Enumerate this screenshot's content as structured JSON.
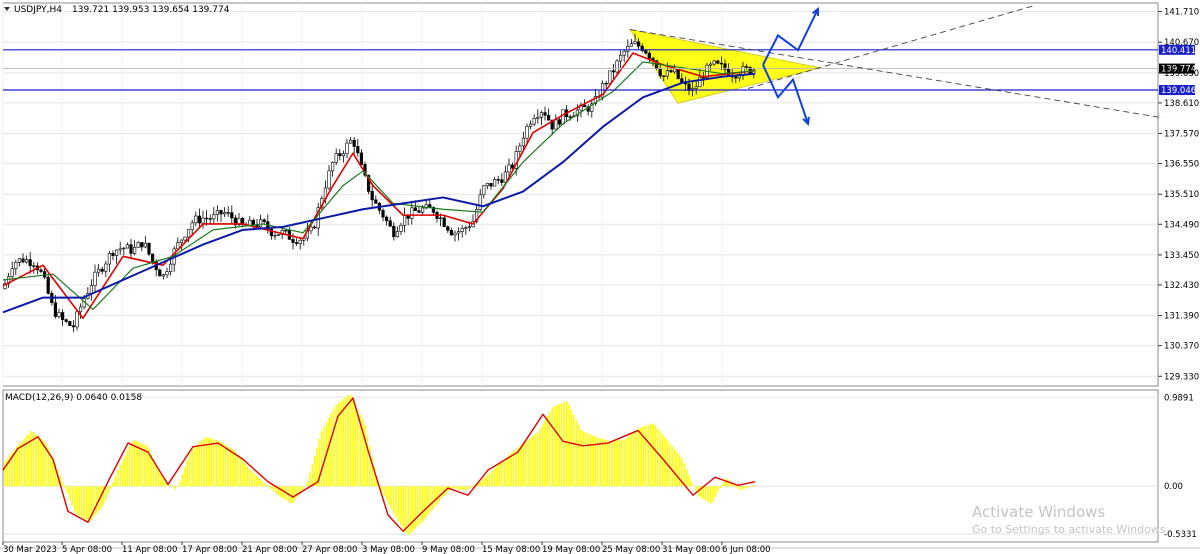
{
  "header": {
    "symbol": "USDJPY,H4",
    "ohlc": "139.721 139.953 139.654 139.774",
    "menu_icon": "triangle-down-icon"
  },
  "macd_label": "MACD(12,26,9) 0.0640 0.0158",
  "price_axis": {
    "ticks": [
      "141.710",
      "140.670",
      "139.630",
      "138.610",
      "137.570",
      "136.550",
      "135.510",
      "134.490",
      "133.450",
      "132.430",
      "131.390",
      "130.370",
      "129.330"
    ],
    "tags": {
      "upper": "140.411",
      "lower": "139.046",
      "current": "139.774"
    }
  },
  "macd_axis": {
    "ticks": [
      "0.9891",
      "0.00",
      "-0.5331"
    ]
  },
  "time_axis": [
    "30 Mar 2023",
    "5 Apr 08:00",
    "11 Apr 08:00",
    "17 Apr 08:00",
    "21 Apr 08:00",
    "27 Apr 08:00",
    "3 May 08:00",
    "9 May 08:00",
    "15 May 08:00",
    "19 May 08:00",
    "25 May 08:00",
    "31 May 08:00",
    "6 Jun 08:00"
  ],
  "watermark": {
    "title": "Activate Windows",
    "subtitle": "Go to Settings to activate Windows."
  },
  "colors": {
    "ma_fast": "#e00000",
    "ma_mid": "#1a7a1a",
    "ma_slow": "#0a1aa8",
    "hline": "#1a20c8",
    "triangle": "#ffff00",
    "macd_hist": "#ffff00",
    "macd_signal": "#e00000",
    "arrows": "#1040e0",
    "price_tag": "#1a20c8",
    "current_tag": "#000000"
  },
  "chart_data": {
    "type": "candlestick",
    "symbol": "USDJPY",
    "timeframe": "H4",
    "ylim": [
      129.0,
      142.0
    ],
    "horizontal_levels": [
      140.411,
      139.046
    ],
    "current_price": 139.774,
    "close_path": [
      {
        "x": 0,
        "y": 132.3
      },
      {
        "x": 10,
        "y": 133.2
      },
      {
        "x": 20,
        "y": 133.3
      },
      {
        "x": 32,
        "y": 133.2
      },
      {
        "x": 40,
        "y": 132.7
      },
      {
        "x": 50,
        "y": 131.6
      },
      {
        "x": 60,
        "y": 131.2
      },
      {
        "x": 70,
        "y": 131.0
      },
      {
        "x": 80,
        "y": 131.9
      },
      {
        "x": 90,
        "y": 132.6
      },
      {
        "x": 100,
        "y": 133.1
      },
      {
        "x": 110,
        "y": 133.6
      },
      {
        "x": 120,
        "y": 133.7
      },
      {
        "x": 130,
        "y": 133.6
      },
      {
        "x": 140,
        "y": 133.9
      },
      {
        "x": 150,
        "y": 133.2
      },
      {
        "x": 160,
        "y": 132.7
      },
      {
        "x": 170,
        "y": 133.5
      },
      {
        "x": 180,
        "y": 134.1
      },
      {
        "x": 190,
        "y": 134.6
      },
      {
        "x": 200,
        "y": 134.7
      },
      {
        "x": 210,
        "y": 134.7
      },
      {
        "x": 220,
        "y": 134.9
      },
      {
        "x": 230,
        "y": 134.7
      },
      {
        "x": 240,
        "y": 134.4
      },
      {
        "x": 250,
        "y": 134.5
      },
      {
        "x": 260,
        "y": 134.5
      },
      {
        "x": 270,
        "y": 134.2
      },
      {
        "x": 280,
        "y": 134.2
      },
      {
        "x": 290,
        "y": 134.0
      },
      {
        "x": 300,
        "y": 134.0
      },
      {
        "x": 310,
        "y": 134.3
      },
      {
        "x": 320,
        "y": 135.6
      },
      {
        "x": 330,
        "y": 136.6
      },
      {
        "x": 340,
        "y": 137.0
      },
      {
        "x": 350,
        "y": 137.4
      },
      {
        "x": 360,
        "y": 136.2
      },
      {
        "x": 370,
        "y": 135.3
      },
      {
        "x": 380,
        "y": 134.8
      },
      {
        "x": 390,
        "y": 134.2
      },
      {
        "x": 400,
        "y": 134.7
      },
      {
        "x": 410,
        "y": 134.9
      },
      {
        "x": 420,
        "y": 135.0
      },
      {
        "x": 430,
        "y": 135.0
      },
      {
        "x": 440,
        "y": 134.6
      },
      {
        "x": 450,
        "y": 134.2
      },
      {
        "x": 460,
        "y": 134.3
      },
      {
        "x": 470,
        "y": 134.6
      },
      {
        "x": 480,
        "y": 135.7
      },
      {
        "x": 490,
        "y": 135.9
      },
      {
        "x": 500,
        "y": 136.1
      },
      {
        "x": 510,
        "y": 136.5
      },
      {
        "x": 520,
        "y": 137.5
      },
      {
        "x": 530,
        "y": 138.2
      },
      {
        "x": 540,
        "y": 138.4
      },
      {
        "x": 550,
        "y": 137.8
      },
      {
        "x": 560,
        "y": 138.2
      },
      {
        "x": 570,
        "y": 138.3
      },
      {
        "x": 580,
        "y": 138.4
      },
      {
        "x": 590,
        "y": 138.5
      },
      {
        "x": 600,
        "y": 139.2
      },
      {
        "x": 610,
        "y": 139.7
      },
      {
        "x": 620,
        "y": 140.3
      },
      {
        "x": 630,
        "y": 140.6
      },
      {
        "x": 640,
        "y": 140.5
      },
      {
        "x": 650,
        "y": 140.1
      },
      {
        "x": 660,
        "y": 139.5
      },
      {
        "x": 670,
        "y": 139.7
      },
      {
        "x": 680,
        "y": 139.2
      },
      {
        "x": 690,
        "y": 139.0
      },
      {
        "x": 700,
        "y": 139.6
      },
      {
        "x": 710,
        "y": 139.9
      },
      {
        "x": 720,
        "y": 139.8
      },
      {
        "x": 730,
        "y": 139.6
      },
      {
        "x": 740,
        "y": 139.7
      },
      {
        "x": 752,
        "y": 139.77
      }
    ],
    "moving_averages": [
      {
        "name": "fast",
        "points": [
          {
            "x": 0,
            "y": 132.4
          },
          {
            "x": 40,
            "y": 133.1
          },
          {
            "x": 80,
            "y": 131.3
          },
          {
            "x": 120,
            "y": 133.4
          },
          {
            "x": 160,
            "y": 133.1
          },
          {
            "x": 200,
            "y": 134.5
          },
          {
            "x": 240,
            "y": 134.5
          },
          {
            "x": 300,
            "y": 134.0
          },
          {
            "x": 330,
            "y": 135.8
          },
          {
            "x": 350,
            "y": 136.9
          },
          {
            "x": 370,
            "y": 135.8
          },
          {
            "x": 400,
            "y": 134.8
          },
          {
            "x": 440,
            "y": 134.8
          },
          {
            "x": 470,
            "y": 134.5
          },
          {
            "x": 500,
            "y": 135.7
          },
          {
            "x": 530,
            "y": 137.6
          },
          {
            "x": 560,
            "y": 138.2
          },
          {
            "x": 600,
            "y": 138.9
          },
          {
            "x": 630,
            "y": 140.3
          },
          {
            "x": 660,
            "y": 139.9
          },
          {
            "x": 700,
            "y": 139.5
          },
          {
            "x": 752,
            "y": 139.7
          }
        ]
      },
      {
        "name": "mid",
        "points": [
          {
            "x": 0,
            "y": 132.6
          },
          {
            "x": 50,
            "y": 132.8
          },
          {
            "x": 90,
            "y": 131.6
          },
          {
            "x": 130,
            "y": 133.0
          },
          {
            "x": 170,
            "y": 133.4
          },
          {
            "x": 210,
            "y": 134.3
          },
          {
            "x": 260,
            "y": 134.5
          },
          {
            "x": 300,
            "y": 134.2
          },
          {
            "x": 340,
            "y": 135.8
          },
          {
            "x": 360,
            "y": 136.3
          },
          {
            "x": 390,
            "y": 135.2
          },
          {
            "x": 440,
            "y": 135.0
          },
          {
            "x": 480,
            "y": 134.9
          },
          {
            "x": 520,
            "y": 136.6
          },
          {
            "x": 560,
            "y": 137.9
          },
          {
            "x": 610,
            "y": 139.0
          },
          {
            "x": 640,
            "y": 140.0
          },
          {
            "x": 680,
            "y": 139.8
          },
          {
            "x": 720,
            "y": 139.6
          },
          {
            "x": 752,
            "y": 139.7
          }
        ]
      },
      {
        "name": "slow",
        "points": [
          {
            "x": 0,
            "y": 131.5
          },
          {
            "x": 40,
            "y": 132.0
          },
          {
            "x": 80,
            "y": 132.0
          },
          {
            "x": 120,
            "y": 132.6
          },
          {
            "x": 160,
            "y": 133.2
          },
          {
            "x": 200,
            "y": 133.8
          },
          {
            "x": 240,
            "y": 134.3
          },
          {
            "x": 280,
            "y": 134.4
          },
          {
            "x": 320,
            "y": 134.7
          },
          {
            "x": 360,
            "y": 135.0
          },
          {
            "x": 400,
            "y": 135.2
          },
          {
            "x": 440,
            "y": 135.4
          },
          {
            "x": 480,
            "y": 135.1
          },
          {
            "x": 520,
            "y": 135.6
          },
          {
            "x": 560,
            "y": 136.6
          },
          {
            "x": 600,
            "y": 137.8
          },
          {
            "x": 640,
            "y": 138.8
          },
          {
            "x": 680,
            "y": 139.3
          },
          {
            "x": 720,
            "y": 139.5
          },
          {
            "x": 752,
            "y": 139.6
          }
        ]
      }
    ],
    "triangle": [
      {
        "x": 627,
        "y": 141.1
      },
      {
        "x": 675,
        "y": 138.6
      },
      {
        "x": 817,
        "y": 139.8
      }
    ],
    "trendlines": [
      {
        "from": {
          "x": 627,
          "y": 141.1
        },
        "to": {
          "x": 1160,
          "y": 138.1
        },
        "style": "dashed"
      },
      {
        "from": {
          "x": 745,
          "y": 139.1
        },
        "to": {
          "x": 1030,
          "y": 141.9
        },
        "style": "dashed"
      }
    ],
    "projections": [
      {
        "name": "bullish",
        "points": [
          {
            "x": 760,
            "y": 139.9
          },
          {
            "x": 775,
            "y": 140.9
          },
          {
            "x": 795,
            "y": 140.4
          },
          {
            "x": 815,
            "y": 141.8
          }
        ]
      },
      {
        "name": "bearish",
        "points": [
          {
            "x": 760,
            "y": 139.9
          },
          {
            "x": 775,
            "y": 138.8
          },
          {
            "x": 790,
            "y": 139.4
          },
          {
            "x": 805,
            "y": 137.9
          }
        ]
      }
    ],
    "macd": {
      "params": "12,26,9",
      "main": 0.064,
      "signal": 0.0158,
      "ylim": [
        -0.62,
        1.07
      ],
      "signal_path": [
        {
          "x": 0,
          "y": 0.18
        },
        {
          "x": 15,
          "y": 0.42
        },
        {
          "x": 35,
          "y": 0.55
        },
        {
          "x": 50,
          "y": 0.3
        },
        {
          "x": 65,
          "y": -0.28
        },
        {
          "x": 85,
          "y": -0.4
        },
        {
          "x": 105,
          "y": 0.05
        },
        {
          "x": 125,
          "y": 0.48
        },
        {
          "x": 145,
          "y": 0.38
        },
        {
          "x": 165,
          "y": 0.02
        },
        {
          "x": 190,
          "y": 0.44
        },
        {
          "x": 215,
          "y": 0.48
        },
        {
          "x": 240,
          "y": 0.3
        },
        {
          "x": 265,
          "y": 0.05
        },
        {
          "x": 290,
          "y": -0.12
        },
        {
          "x": 315,
          "y": 0.05
        },
        {
          "x": 335,
          "y": 0.78
        },
        {
          "x": 350,
          "y": 0.98
        },
        {
          "x": 365,
          "y": 0.4
        },
        {
          "x": 385,
          "y": -0.32
        },
        {
          "x": 400,
          "y": -0.5
        },
        {
          "x": 420,
          "y": -0.28
        },
        {
          "x": 445,
          "y": -0.02
        },
        {
          "x": 465,
          "y": -0.1
        },
        {
          "x": 485,
          "y": 0.18
        },
        {
          "x": 515,
          "y": 0.38
        },
        {
          "x": 540,
          "y": 0.8
        },
        {
          "x": 560,
          "y": 0.5
        },
        {
          "x": 580,
          "y": 0.45
        },
        {
          "x": 605,
          "y": 0.48
        },
        {
          "x": 635,
          "y": 0.62
        },
        {
          "x": 660,
          "y": 0.3
        },
        {
          "x": 690,
          "y": -0.1
        },
        {
          "x": 712,
          "y": 0.1
        },
        {
          "x": 735,
          "y": 0.01
        },
        {
          "x": 752,
          "y": 0.05
        }
      ],
      "histogram": [
        0.25,
        0.45,
        0.62,
        0.48,
        0.1,
        -0.3,
        -0.4,
        -0.2,
        0.2,
        0.52,
        0.45,
        0.1,
        -0.05,
        0.4,
        0.55,
        0.5,
        0.4,
        0.2,
        0.05,
        -0.1,
        -0.2,
        0.02,
        0.6,
        0.9,
        1.03,
        0.7,
        0.0,
        -0.3,
        -0.55,
        -0.4,
        -0.2,
        -0.02,
        -0.05,
        0.05,
        0.2,
        0.35,
        0.48,
        0.6,
        0.88,
        0.95,
        0.62,
        0.55,
        0.5,
        0.52,
        0.65,
        0.7,
        0.5,
        0.3,
        -0.1,
        -0.2,
        0.1,
        -0.05,
        0.02
      ]
    }
  }
}
